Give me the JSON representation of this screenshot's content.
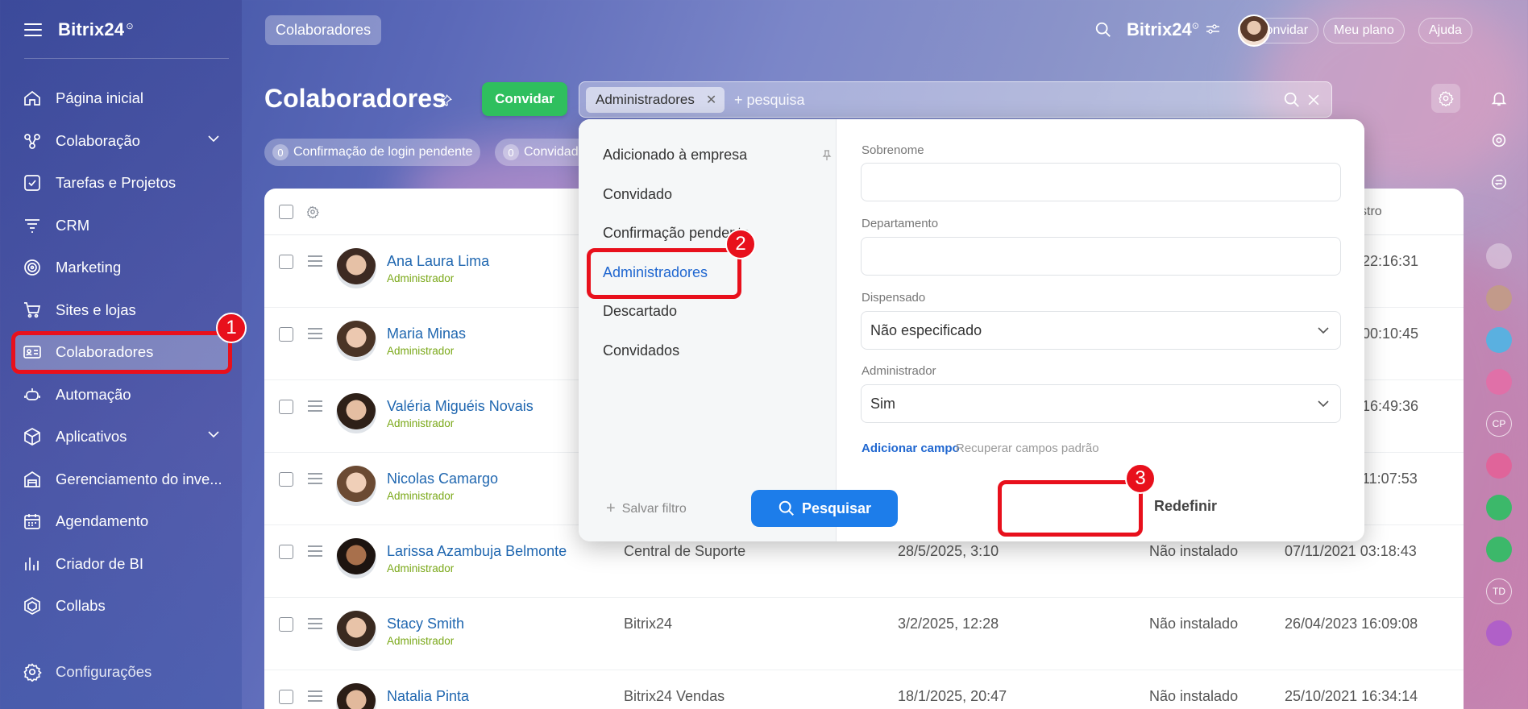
{
  "sidebar": {
    "logo": "Bitrix24",
    "logo_mark": "⊙",
    "items": [
      {
        "label": "Página inicial",
        "icon": "home-icon",
        "has_chevron": false
      },
      {
        "label": "Colaboração",
        "icon": "collab-icon",
        "has_chevron": true
      },
      {
        "label": "Tarefas e Projetos",
        "icon": "tasks-icon",
        "has_chevron": false
      },
      {
        "label": "CRM",
        "icon": "crm-icon",
        "has_chevron": false
      },
      {
        "label": "Marketing",
        "icon": "marketing-icon",
        "has_chevron": false
      },
      {
        "label": "Sites e lojas",
        "icon": "cart-icon",
        "has_chevron": false
      },
      {
        "label": "Colaboradores",
        "icon": "employees-icon",
        "has_chevron": false,
        "active": true
      },
      {
        "label": "Automação",
        "icon": "robot-icon",
        "has_chevron": false
      },
      {
        "label": "Aplicativos",
        "icon": "apps-icon",
        "has_chevron": true
      },
      {
        "label": "Gerenciamento do inve...",
        "icon": "inventory-icon",
        "has_chevron": false
      },
      {
        "label": "Agendamento",
        "icon": "calendar-icon",
        "has_chevron": false
      },
      {
        "label": "Criador de BI",
        "icon": "bi-icon",
        "has_chevron": false
      },
      {
        "label": "Collabs",
        "icon": "collabs-icon",
        "has_chevron": false
      }
    ],
    "settings_label": "Configurações"
  },
  "topbar": {
    "breadcrumb": "Colaboradores",
    "logo": "Bitrix24",
    "logo_mark": "⊙",
    "invite_label": "Convidar",
    "plan_label": "Meu plano",
    "help_label": "Ajuda"
  },
  "page": {
    "title": "Colaboradores",
    "invite_button": "Convidar",
    "filter_chip": "Administradores",
    "search_placeholder": "+ pesquisa",
    "counters": [
      {
        "count": "0",
        "label": "Confirmação de login pendente"
      },
      {
        "count": "0",
        "label": "Convidad"
      }
    ]
  },
  "table": {
    "partial_header": "stro",
    "rows": [
      {
        "name": "Ana Laura Lima",
        "role": "Administrador",
        "dept": "",
        "date": "",
        "app": "",
        "reg": "22:16:31"
      },
      {
        "name": "Maria Minas",
        "role": "Administrador",
        "dept": "",
        "date": "",
        "app": "",
        "reg": "00:10:45"
      },
      {
        "name": "Valéria Miguéis Novais",
        "role": "Administrador",
        "dept": "",
        "date": "",
        "app": "",
        "reg": "16:49:36"
      },
      {
        "name": "Nicolas Camargo",
        "role": "Administrador",
        "dept": "",
        "date": "",
        "app": "",
        "reg": "11:07:53"
      },
      {
        "name": "Larissa Azambuja Belmonte",
        "role": "Administrador",
        "dept": "Central de Suporte",
        "date": "28/5/2025, 3:10",
        "app": "Não instalado",
        "reg": "07/11/2021 03:18:43"
      },
      {
        "name": "Stacy Smith",
        "role": "Administrador",
        "dept": "Bitrix24",
        "date": "3/2/2025, 12:28",
        "app": "Não instalado",
        "reg": "26/04/2023 16:09:08"
      },
      {
        "name": "Natalia Pinta",
        "role": "",
        "dept": "Bitrix24     Vendas",
        "date": "18/1/2025, 20:47",
        "app": "Não instalado",
        "reg": "25/10/2021 16:34:14"
      }
    ]
  },
  "filter_panel": {
    "presets": [
      "Adicionado à empresa",
      "Convidado",
      "Confirmação pendente",
      "Administradores",
      "Descartado",
      "Convidados"
    ],
    "selected_preset": "Administradores",
    "save_filter": "Salvar filtro",
    "fields": {
      "surname_label": "Sobrenome",
      "surname_value": "",
      "department_label": "Departamento",
      "department_value": "",
      "dismissed_label": "Dispensado",
      "dismissed_value": "Não especificado",
      "admin_label": "Administrador",
      "admin_value": "Sim"
    },
    "add_field": "Adicionar campo",
    "restore_fields": "Recuperar campos padrão",
    "search_button": "Pesquisar",
    "reset_button": "Redefinir"
  },
  "annotations": [
    "1",
    "2",
    "3"
  ],
  "colors": {
    "accent": "#1d7dea",
    "invite": "#2fbf5e",
    "annotation": "#e8101c",
    "role": "#7aa818",
    "link": "#2067b0"
  }
}
